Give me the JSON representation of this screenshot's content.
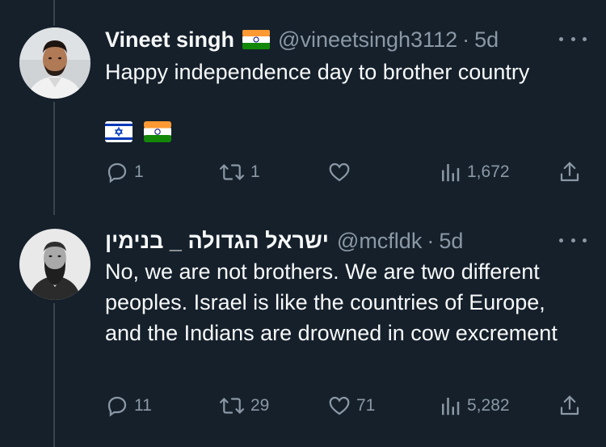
{
  "tweets": [
    {
      "name": "Vineet singh",
      "handle": "@vineetsingh3112",
      "dot": "·",
      "time": "5d",
      "text": "Happy independence day to brother country",
      "flags": [
        "israel-flag",
        "india-flag"
      ],
      "replies": "1",
      "retweets": "1",
      "likes": "",
      "views": "1,672"
    },
    {
      "name": "ישראל הגדולה _ בנימין",
      "handle": "@mcfldk",
      "dot": "·",
      "time": "5d",
      "text": "No, we are not brothers. We are two different peoples. Israel is like the countries of Europe, and the Indians are drowned in cow excrement",
      "replies": "11",
      "retweets": "29",
      "likes": "71",
      "views": "5,282"
    }
  ],
  "colors": {
    "background": "#15202b",
    "text": "#f7f9f9",
    "muted": "#8b98a5",
    "divider": "#38444d"
  }
}
